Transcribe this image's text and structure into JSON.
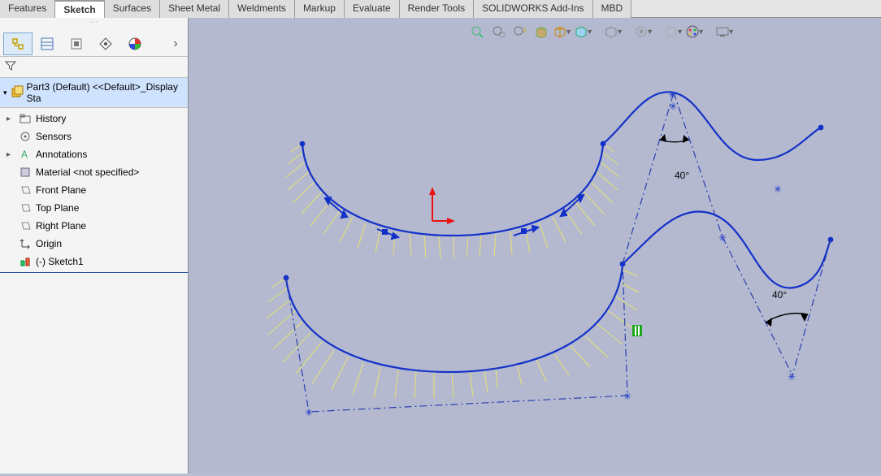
{
  "tabs": {
    "items": [
      {
        "label": "Features"
      },
      {
        "label": "Sketch"
      },
      {
        "label": "Surfaces"
      },
      {
        "label": "Sheet Metal"
      },
      {
        "label": "Weldments"
      },
      {
        "label": "Markup"
      },
      {
        "label": "Evaluate"
      },
      {
        "label": "Render Tools"
      },
      {
        "label": "SOLIDWORKS Add-Ins"
      },
      {
        "label": "MBD"
      }
    ],
    "active_index": 1
  },
  "feature_tree": {
    "root_label": "Part3 (Default) <<Default>_Display Sta",
    "items": [
      {
        "label": "History"
      },
      {
        "label": "Sensors"
      },
      {
        "label": "Annotations"
      },
      {
        "label": "Material <not specified>"
      },
      {
        "label": "Front Plane"
      },
      {
        "label": "Top Plane"
      },
      {
        "label": "Right Plane"
      },
      {
        "label": "Origin"
      },
      {
        "label": "(-) Sketch1"
      }
    ]
  },
  "dimensions": {
    "angle1": "40°",
    "angle2": "40°"
  },
  "viewport_tools": {
    "names": [
      "zoom-fit",
      "zoom-area",
      "zoom-prev",
      "section",
      "view-orient",
      "display-style",
      "hide-show",
      "scene",
      "appearances",
      "render",
      "view-settings"
    ]
  },
  "colors": {
    "sketch_blue": "#1331c8",
    "comb_yellow": "#e7e36f",
    "construction": "#2a3fb0",
    "green_relation": "#1aa81a"
  }
}
